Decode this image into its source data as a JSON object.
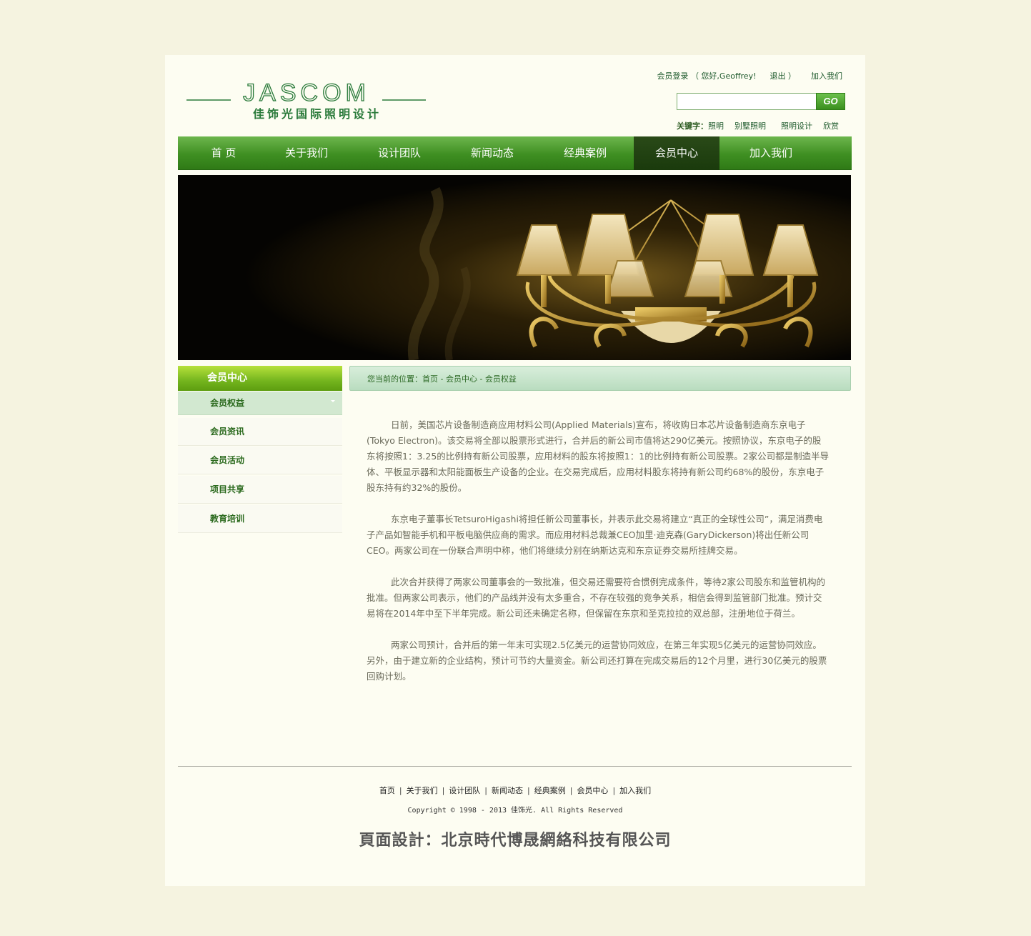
{
  "header": {
    "logo_text": "JASCOM",
    "logo_subtitle": "佳饰光国际照明设计",
    "member_login": "会员登录",
    "greeting": "（ 您好,Geoffrey!",
    "logout": "退出 ）",
    "join_us": "加入我们",
    "search_button": "GO",
    "search_placeholder": "",
    "keywords_label": "关键字：",
    "keywords": [
      "照明",
      "别墅照明",
      "照明设计",
      "欣赏"
    ]
  },
  "nav": {
    "items": [
      "首 页",
      "关于我们",
      "设计团队",
      "新闻动态",
      "经典案例",
      "会员中心",
      "加入我们"
    ],
    "active_index": 5
  },
  "sidebar": {
    "title": "会员中心",
    "items": [
      "会员权益",
      "会员资讯",
      "会员活动",
      "项目共享",
      "教育培训"
    ],
    "active_index": 0
  },
  "breadcrumb": "您当前的位置：首页 - 会员中心 - 会员权益",
  "article": {
    "paragraphs": [
      "日前，美国芯片设备制造商应用材料公司(Applied Materials)宣布，将收购日本芯片设备制造商东京电子(Tokyo Electron)。该交易将全部以股票形式进行，合并后的新公司市值将达290亿美元。按照协议，东京电子的股东将按照1：3.25的比例持有新公司股票，应用材料的股东将按照1：1的比例持有新公司股票。2家公司都是制造半导体、平板显示器和太阳能面板生产设备的企业。在交易完成后，应用材料股东将持有新公司约68%的股份，东京电子股东持有约32%的股份。",
      "东京电子董事长TetsuroHigashi将担任新公司董事长，并表示此交易将建立“真正的全球性公司”，满足消费电子产品如智能手机和平板电脑供应商的需求。而应用材料总裁兼CEO加里·迪克森(GaryDickerson)将出任新公司CEO。两家公司在一份联合声明中称，他们将继续分别在纳斯达克和东京证券交易所挂牌交易。",
      "此次合并获得了两家公司董事会的一致批准，但交易还需要符合惯例完成条件，等待2家公司股东和监管机构的批准。但两家公司表示，他们的产品线并没有太多重合，不存在较强的竞争关系，相信会得到监管部门批准。预计交易将在2014年中至下半年完成。新公司还未确定名称，但保留在东京和圣克拉拉的双总部，注册地位于荷兰。",
      "两家公司预计，合并后的第一年末可实现2.5亿美元的运营协同效应，在第三年实现5亿美元的运营协同效应。另外，由于建立新的企业结构，预计可节约大量资金。新公司还打算在完成交易后的12个月里，进行30亿美元的股票回购计划。"
    ]
  },
  "footer": {
    "links": [
      "首页",
      "关于我们",
      "设计团队",
      "新闻动态",
      "经典案例",
      "会员中心",
      "加入我们"
    ],
    "separator": "|",
    "copyright": "Copyright © 1998 - 2013 佳饰光. All Rights Reserved",
    "designer": "頁面設計：北京時代博晟網絡科技有限公司"
  },
  "colors": {
    "page_bg": "#f5f3e0",
    "content_bg": "#fdfdf2",
    "brand_green": "#2a7a3a",
    "nav_green": "#3f8f22",
    "nav_active": "#1a3a0c"
  }
}
